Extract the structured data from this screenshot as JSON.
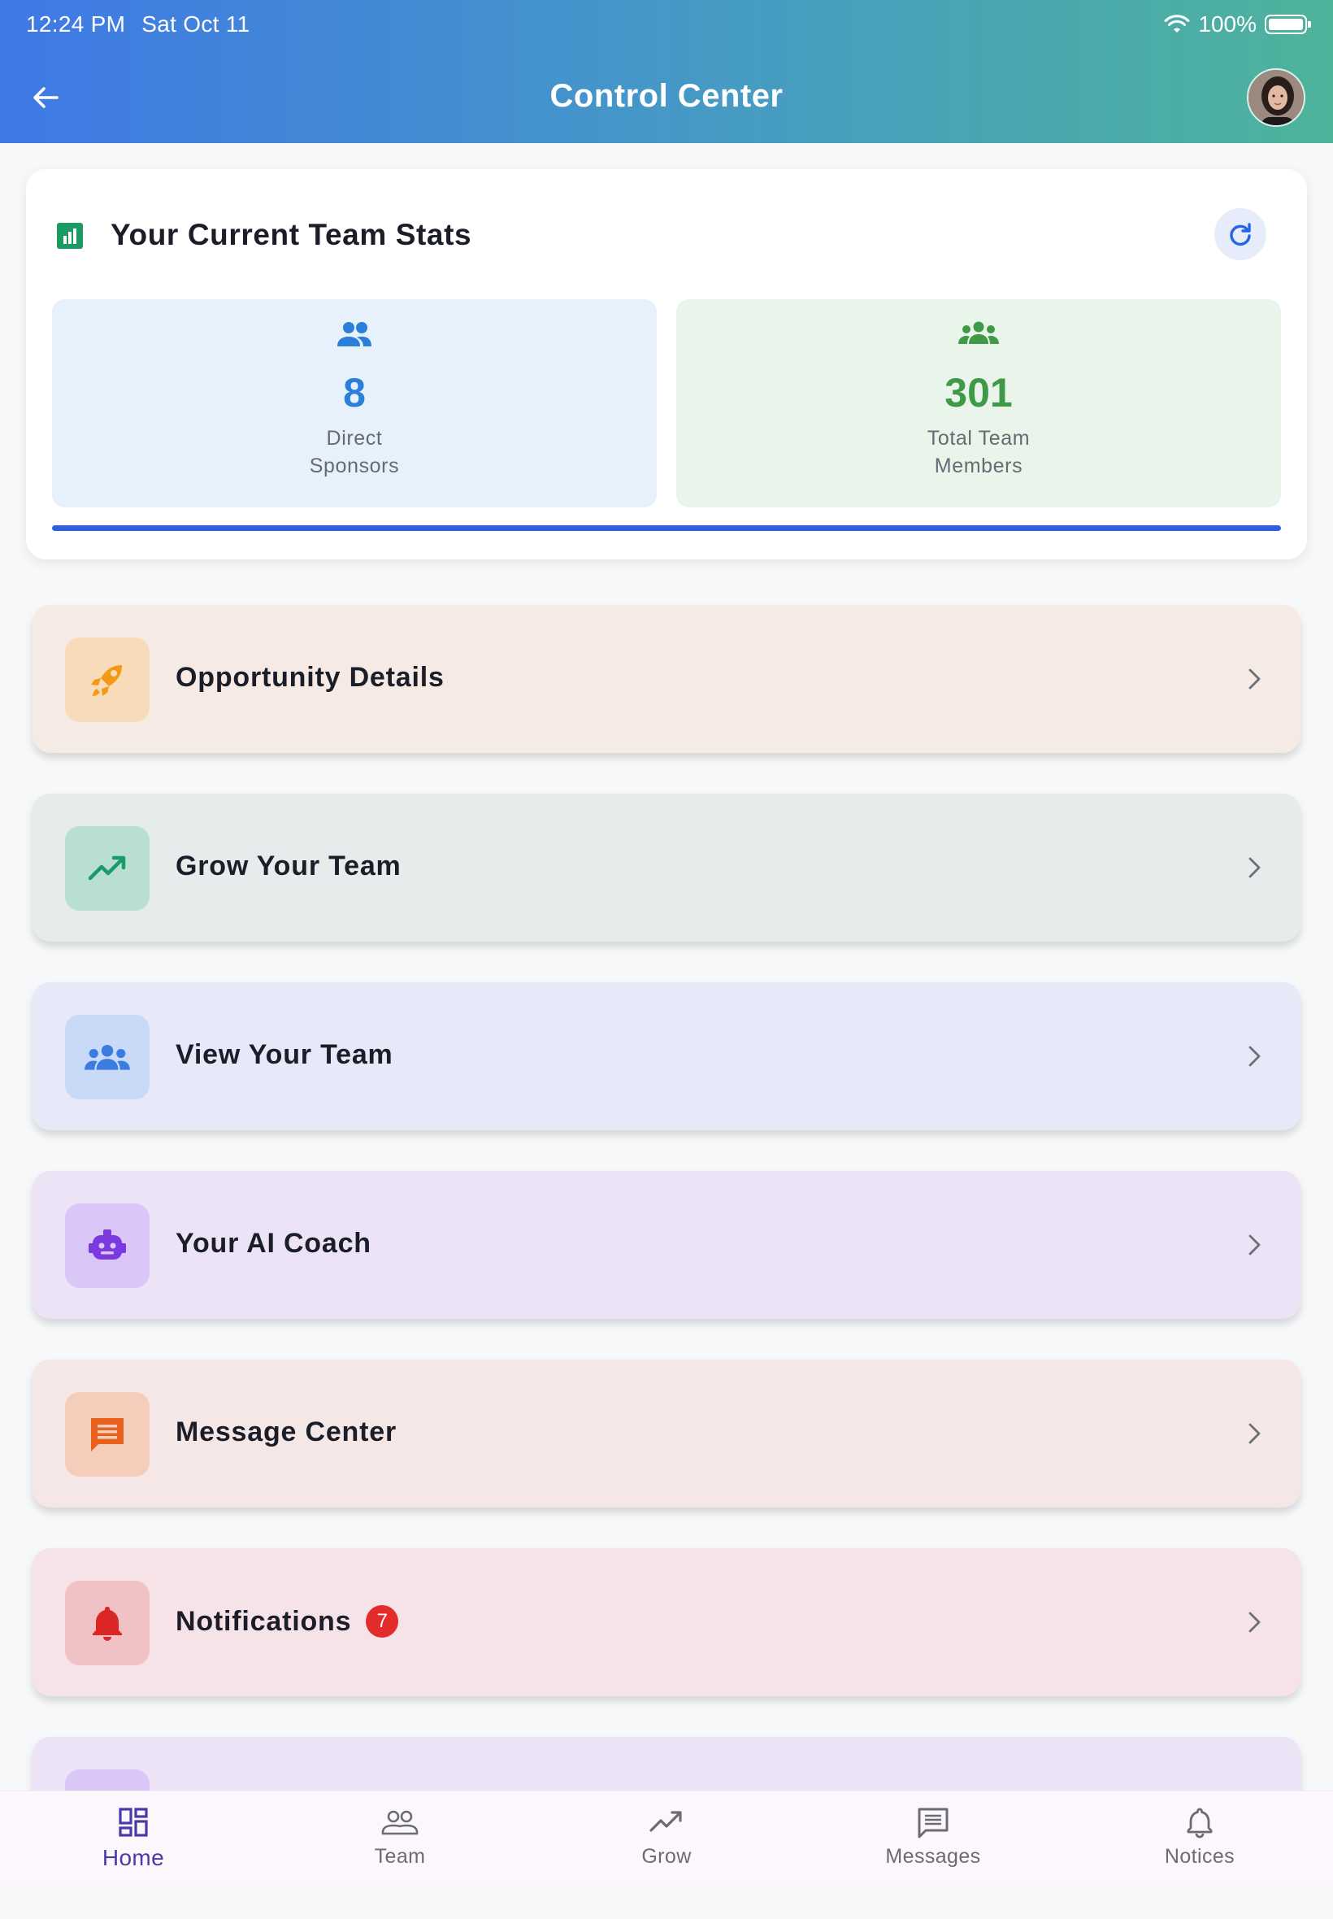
{
  "status_bar": {
    "time": "12:24 PM",
    "date": "Sat Oct 11",
    "battery": "100%"
  },
  "header": {
    "title": "Control Center"
  },
  "stats": {
    "title": "Your Current Team Stats",
    "direct_sponsors": {
      "value": "8",
      "label_line1": "Direct",
      "label_line2": "Sponsors"
    },
    "total_team": {
      "value": "301",
      "label_line1": "Total Team",
      "label_line2": "Members"
    },
    "progress_fraction": 1.0
  },
  "menu": [
    {
      "label": "Opportunity Details",
      "icon": "rocket-icon",
      "bg": "#f6ebe4",
      "icon_bg": "#f8dbb9",
      "icon_color": "#f29a16"
    },
    {
      "label": "Grow Your Team",
      "icon": "trending-up-icon",
      "bg": "#e6ebec",
      "icon_bg": "#b8dfd2",
      "icon_color": "#1b9a6a"
    },
    {
      "label": "View Your Team",
      "icon": "groups-icon",
      "bg": "#e8e9f8",
      "icon_bg": "#c9daf8",
      "icon_color": "#3c7be0"
    },
    {
      "label": "Your AI Coach",
      "icon": "robot-icon",
      "bg": "#ece4f6",
      "icon_bg": "#dac7f7",
      "icon_color": "#7a3ae0"
    },
    {
      "label": "Message Center",
      "icon": "message-icon",
      "bg": "#f5e7e5",
      "icon_bg": "#f5cdbb",
      "icon_color": "#e8601c"
    },
    {
      "label": "Notifications",
      "icon": "bell-icon",
      "bg": "#f5e3e7",
      "icon_bg": "#f0c2c6",
      "icon_color": "#dc2626",
      "badge": "7"
    }
  ],
  "bottom_nav": [
    {
      "label": "Home",
      "icon": "dashboard-icon",
      "active": true
    },
    {
      "label": "Team",
      "icon": "people-icon",
      "active": false
    },
    {
      "label": "Grow",
      "icon": "trending-up-icon",
      "active": false
    },
    {
      "label": "Messages",
      "icon": "chat-icon",
      "active": false
    },
    {
      "label": "Notices",
      "icon": "bell-outline-icon",
      "active": false
    }
  ],
  "colors": {
    "header_gradient_start": "#3f79e6",
    "header_gradient_end": "#4eb39b",
    "accent_blue": "#2b7fd8",
    "accent_green": "#3f9a47",
    "active_nav": "#4a3aa8"
  }
}
